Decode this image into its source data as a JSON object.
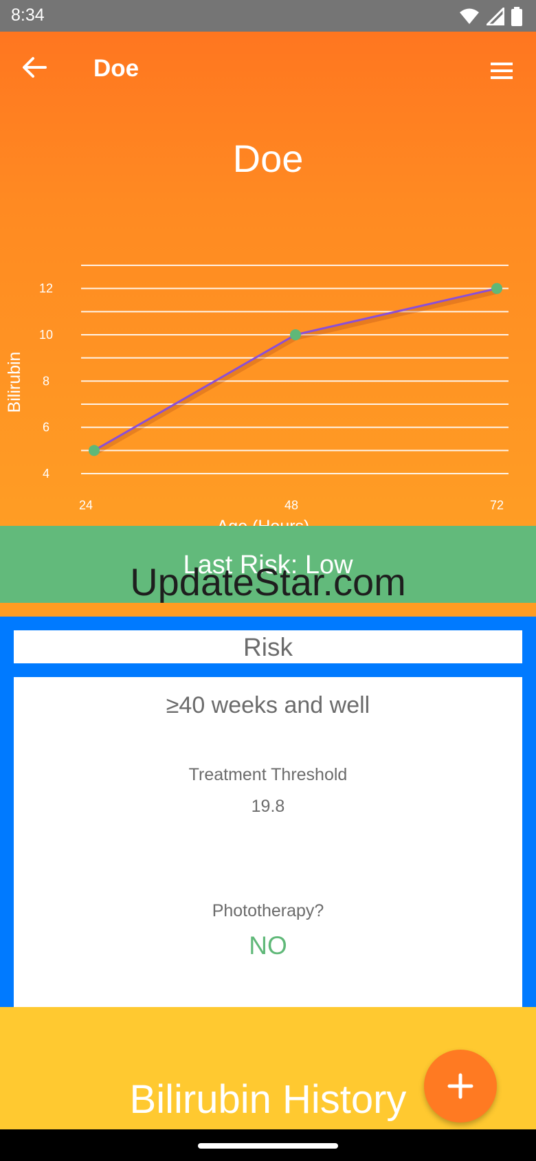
{
  "status_bar": {
    "time": "8:34",
    "icons": [
      "wifi-icon",
      "signal-icon",
      "battery-icon"
    ]
  },
  "app_bar": {
    "title": "Doe",
    "back_icon": "arrow-left-icon",
    "menu_icon": "hamburger-menu-icon"
  },
  "patient_name": "Doe",
  "chart_data": {
    "type": "line",
    "title": "",
    "xlabel": "Age (Hours)",
    "ylabel": "Bilirubin",
    "x": [
      24,
      48,
      72
    ],
    "xticks": [
      "24",
      "48",
      "72"
    ],
    "yticks": [
      "4",
      "6",
      "8",
      "10",
      "12"
    ],
    "ylim": [
      4,
      13
    ],
    "series": [
      {
        "values": [
          5,
          10,
          12
        ]
      }
    ],
    "grid": true,
    "colors": {
      "line": "#8a4fd8",
      "point": "#5fb878",
      "grid": "#ffffff"
    }
  },
  "risk_banner": {
    "text": "Last Risk: Low",
    "color": "#62ba7b"
  },
  "watermark": "UpdateStar.com",
  "risk_panel": {
    "header": "Risk",
    "category": "≥40 weeks and well",
    "threshold_label": "Treatment Threshold",
    "threshold_value": "19.8",
    "phototherapy_label": "Phototherapy?",
    "phototherapy_value": "NO"
  },
  "history": {
    "title": "Bilirubin History",
    "fab_icon": "plus-icon"
  },
  "colors": {
    "hero_top": "#ff7620",
    "hero_bottom": "#ff9d24",
    "panel_border": "#007aff",
    "history_bg": "#ffc930",
    "fab": "#ff7a22"
  }
}
